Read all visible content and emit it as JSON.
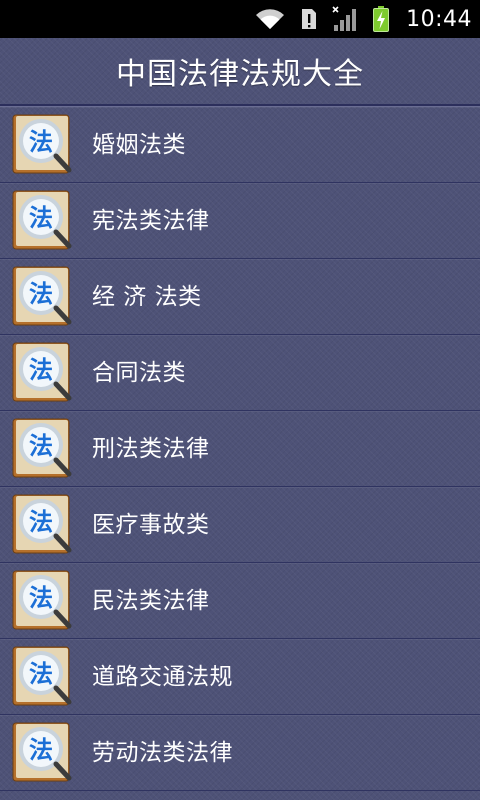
{
  "status_bar": {
    "time": "10:44",
    "icons": [
      "wifi-icon",
      "alert-notification-icon",
      "signal-no-service-icon",
      "battery-charging-icon"
    ]
  },
  "header": {
    "title": "中国法律法规大全"
  },
  "list": {
    "icon_glyph": "法",
    "items": [
      {
        "label": "婚姻法类"
      },
      {
        "label": "宪法类法律"
      },
      {
        "label": "经 济 法类"
      },
      {
        "label": "合同法类"
      },
      {
        "label": "刑法类法律"
      },
      {
        "label": "医疗事故类"
      },
      {
        "label": "民法类法律"
      },
      {
        "label": "道路交通法规"
      },
      {
        "label": "劳动法类法律"
      }
    ]
  },
  "colors": {
    "background": "#4e5277",
    "status_bar": "#000000",
    "battery": "#7ecb2e",
    "icon_book": "#c07a2c",
    "icon_glyph": "#1c6fd6"
  }
}
